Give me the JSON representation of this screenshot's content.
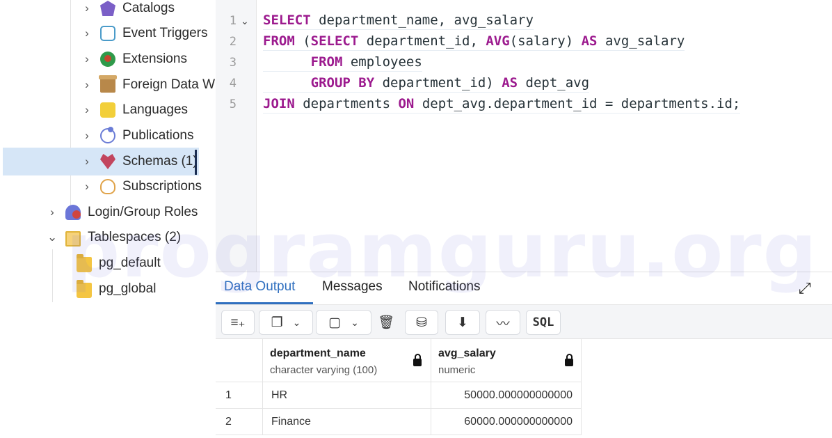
{
  "sidebar": {
    "items": [
      {
        "label": "Catalogs",
        "icon": "catalog-icon"
      },
      {
        "label": "Event Triggers",
        "icon": "event-trigger-icon"
      },
      {
        "label": "Extensions",
        "icon": "extension-icon"
      },
      {
        "label": "Foreign Data W",
        "icon": "foreign-data-wrapper-icon"
      },
      {
        "label": "Languages",
        "icon": "language-icon"
      },
      {
        "label": "Publications",
        "icon": "publication-icon"
      },
      {
        "label": "Schemas (1)",
        "icon": "schema-icon",
        "selected": true
      },
      {
        "label": "Subscriptions",
        "icon": "subscription-icon"
      },
      {
        "label": "Login/Group Roles",
        "icon": "roles-icon"
      },
      {
        "label": "Tablespaces (2)",
        "icon": "folder-icon",
        "expanded": true
      },
      {
        "label": "pg_default",
        "icon": "folder-icon"
      },
      {
        "label": "pg_global",
        "icon": "folder-icon"
      }
    ]
  },
  "editor": {
    "line_numbers": [
      "1",
      "2",
      "3",
      "4",
      "5"
    ],
    "fold_marker": "⌄",
    "lines": [
      "SELECT department_name, avg_salary",
      "FROM (SELECT department_id, AVG(salary) AS avg_salary",
      "      FROM employees",
      "      GROUP BY department_id) AS dept_avg",
      "JOIN departments ON dept_avg.department_id = departments.id;"
    ]
  },
  "results": {
    "tabs": [
      "Data Output",
      "Messages",
      "Notifications"
    ],
    "active_tab": "Data Output",
    "toolbar": {
      "sql_label": "SQL"
    },
    "columns": [
      {
        "name": "department_name",
        "type": "character varying (100)"
      },
      {
        "name": "avg_salary",
        "type": "numeric"
      }
    ],
    "rows": [
      {
        "num": "1",
        "department_name": "HR",
        "avg_salary": "50000.000000000000"
      },
      {
        "num": "2",
        "department_name": "Finance",
        "avg_salary": "60000.000000000000"
      }
    ]
  },
  "watermark": "programguru.org",
  "colors": {
    "keyword": "#9c1a8e",
    "accent": "#2f6fbf",
    "selection": "#d6e6f7"
  }
}
